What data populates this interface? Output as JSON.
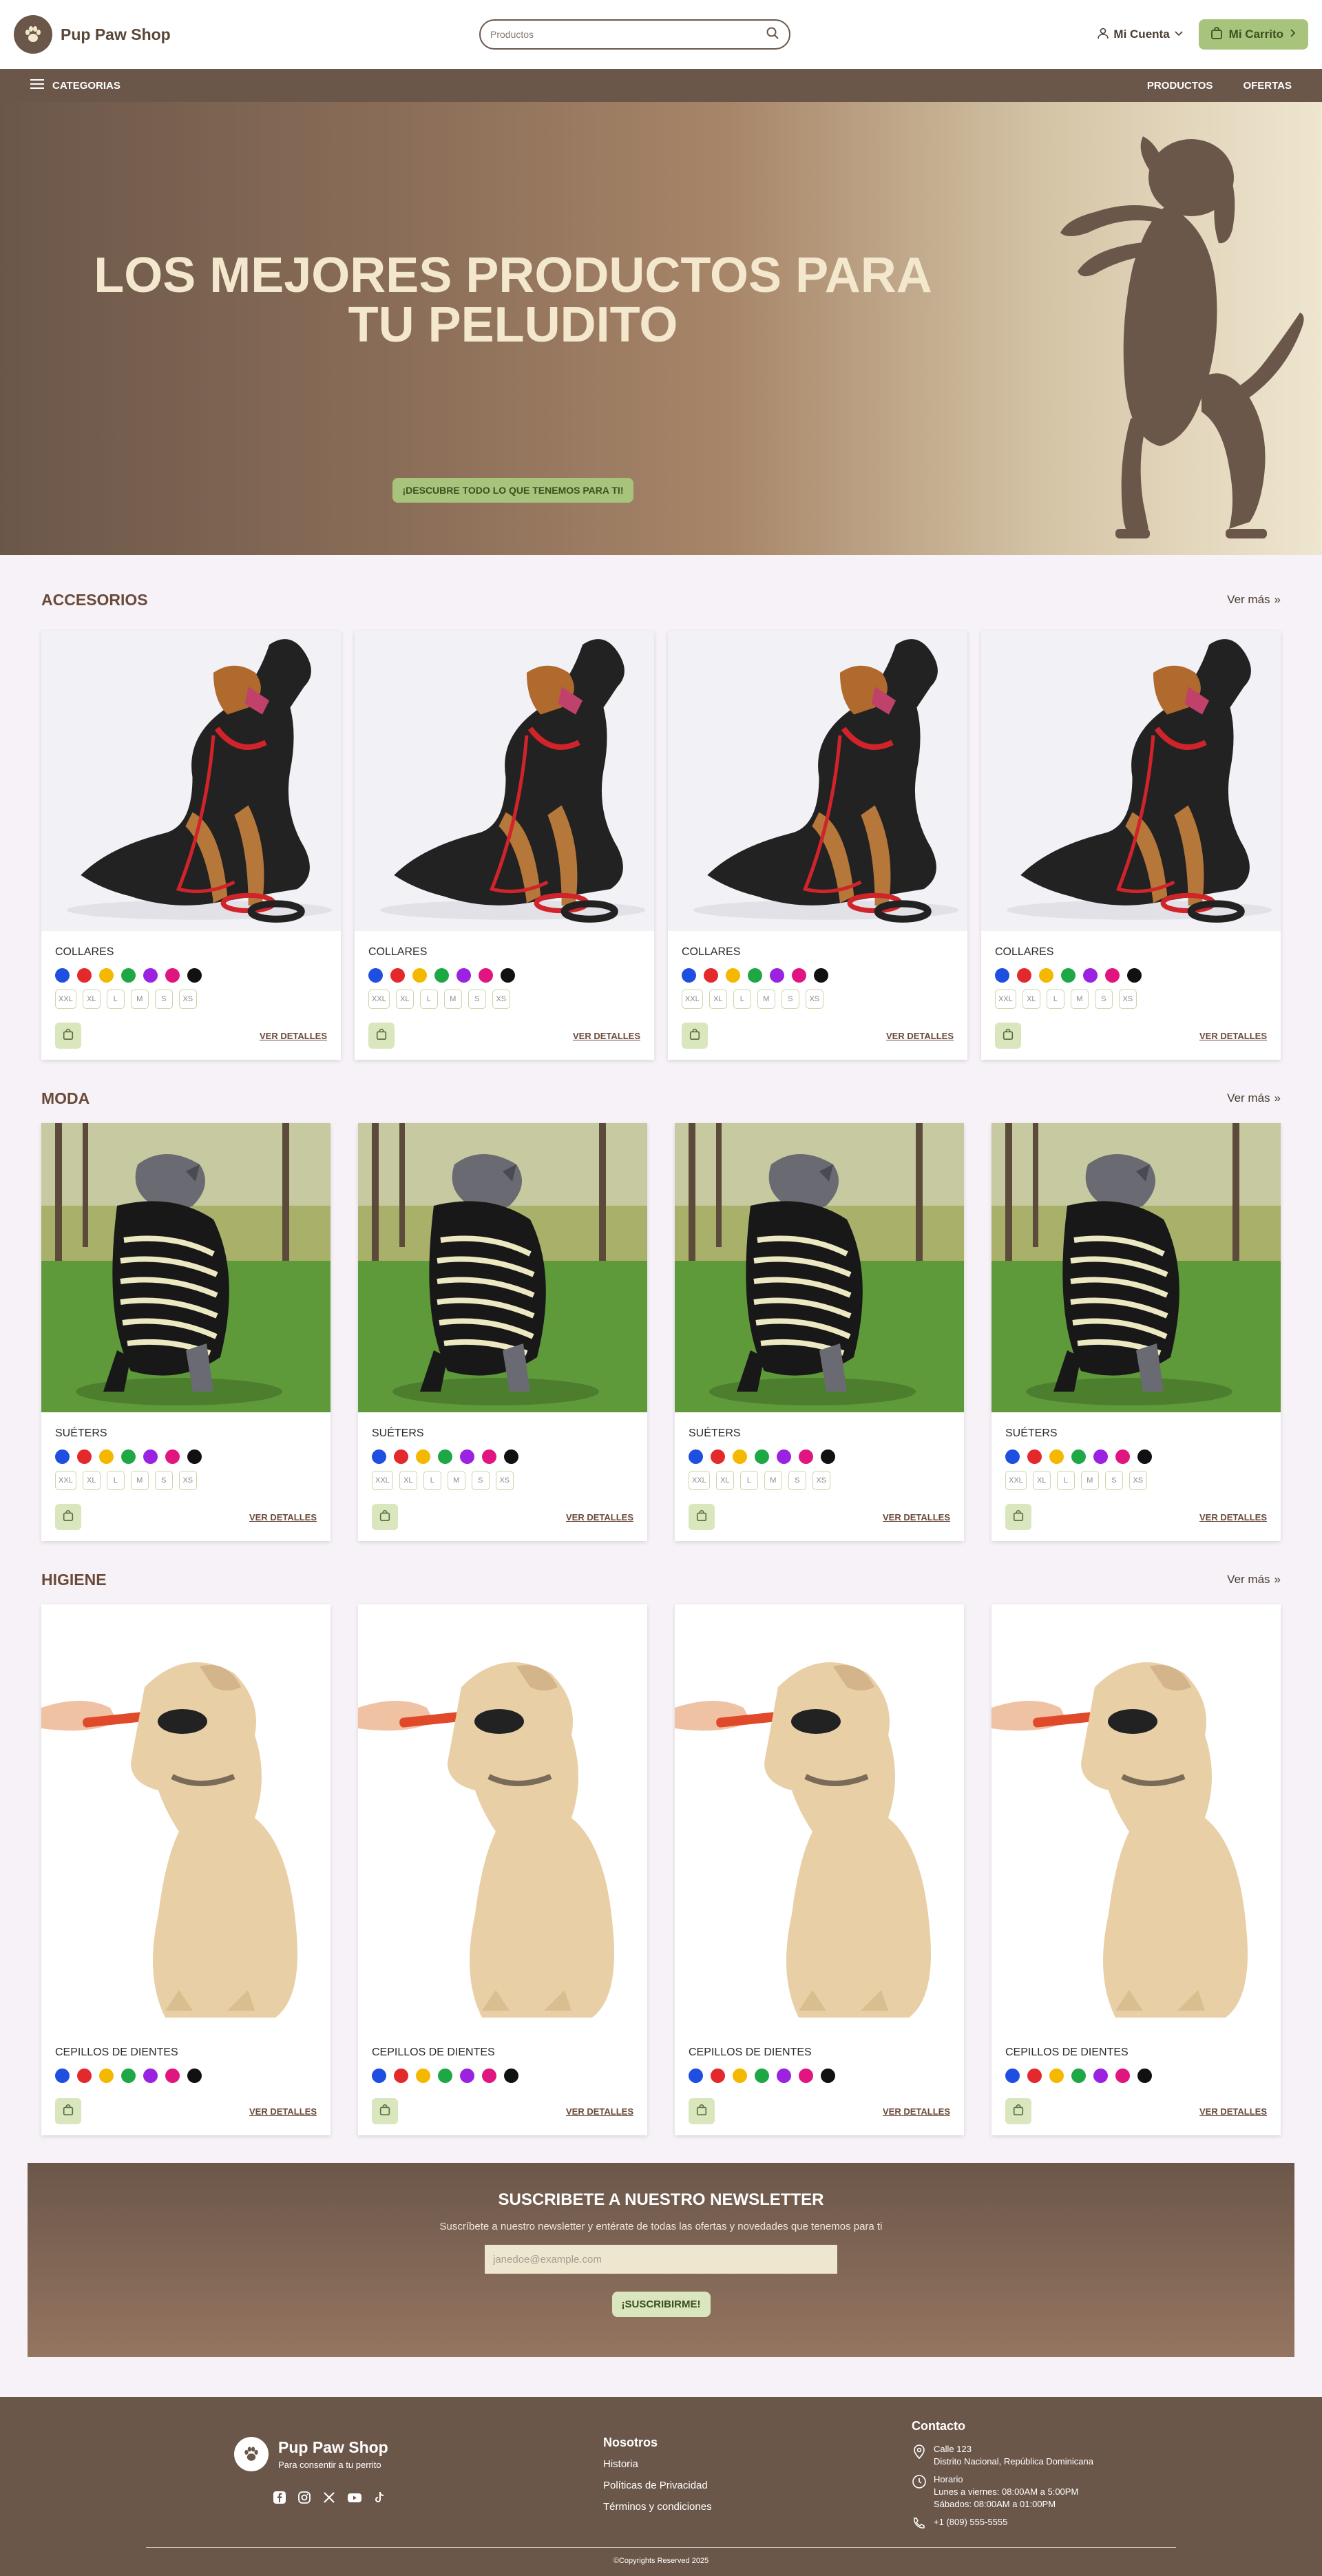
{
  "header": {
    "brand": "Pup Paw Shop",
    "search_placeholder": "Productos",
    "account_label": "Mi Cuenta",
    "cart_label": "Mi Carrito"
  },
  "nav": {
    "categories": "CATEGORIAS",
    "products": "PRODUCTOS",
    "offers": "OFERTAS"
  },
  "hero": {
    "title": "LOS MEJORES PRODUCTOS PARA TU PELUDITO",
    "button": "¡DESCUBRE TODO LO QUE TENEMOS PARA TI!"
  },
  "colors": {
    "brand_brown": "#6b574a",
    "accent_green": "#a8c47c",
    "cream": "#efe6d0"
  },
  "swatches": [
    "#1f4fe0",
    "#e3292b",
    "#f5b800",
    "#1ea845",
    "#9a22e0",
    "#e0157f",
    "#111111"
  ],
  "sections": [
    {
      "title": "ACCESORIOS",
      "see_more": "Ver más",
      "product": "COLLARES",
      "sizes": [
        "XXL",
        "XL",
        "L",
        "M",
        "S",
        "XS"
      ],
      "details": "VER DETALLES"
    },
    {
      "title": "MODA",
      "see_more": "Ver más",
      "product": "SUÉTERS",
      "sizes": [
        "XXL",
        "XL",
        "L",
        "M",
        "S",
        "XS"
      ],
      "details": "VER DETALLES"
    },
    {
      "title": "HIGIENE",
      "see_more": "Ver más",
      "product": "CEPILLOS DE DIENTES",
      "details": "VER DETALLES"
    }
  ],
  "newsletter": {
    "title": "SUSCRIBETE A NUESTRO NEWSLETTER",
    "text": "Suscríbete a nuestro newsletter y entérate de todas las ofertas y novedades que tenemos para ti",
    "placeholder": "janedoe@example.com",
    "button": "¡SUSCRIBIRME!"
  },
  "footer": {
    "brand": "Pup Paw Shop",
    "tagline": "Para consentir a tu perrito",
    "about_title": "Nosotros",
    "links": [
      "Historia",
      "Políticas de Privacidad",
      "Términos y condiciones"
    ],
    "contact_title": "Contacto",
    "address1": "Calle 123",
    "address2": "Distrito Nacional, República Dominicana",
    "hours_title": "Horario",
    "hours1": "Lunes a viernes: 08:00AM a 5:00PM",
    "hours2": "Sábados: 08:00AM a 01:00PM",
    "phone": "+1 (809) 555-5555",
    "copyright": "©Copyrights Reserved 2025"
  }
}
